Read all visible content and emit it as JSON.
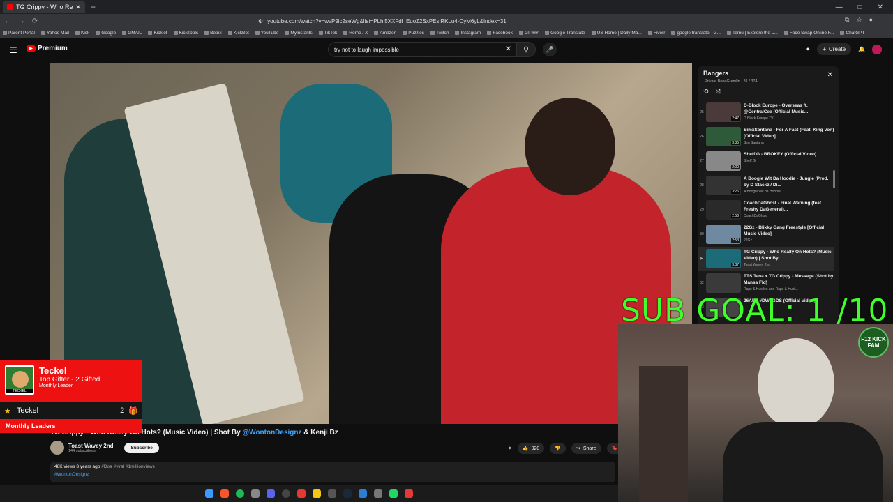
{
  "browser": {
    "tab_title": "TG Crippy - Who Really On Hots",
    "new_tab": "+",
    "url": "youtube.com/watch?v=wvP9ic2seWg&list=PLhl5XXFdl_EuoZ2SxPEslRKLu4-CyM6yL&index=31",
    "window_controls": [
      "—",
      "□",
      "✕"
    ],
    "bookmarks": [
      "Parent Portal",
      "Yahoo Mail",
      "Kick",
      "Google",
      "GMAIL",
      "Kicklet",
      "KickTools",
      "Botrix",
      "KickBot",
      "YouTube",
      "MyInstants",
      "TikTok",
      "Home / X",
      "Amazon",
      "Puzzles",
      "Twitch",
      "Instagram",
      "Facebook",
      "GIPHY",
      "Google Translate",
      "US Home | Daily Ma...",
      "Fiverr",
      "google translate - G...",
      "Temu | Explore the L...",
      "Face Swap Online F...",
      "ChatGPT"
    ]
  },
  "youtube": {
    "logo": "Premium",
    "search_query": "try not to laugh impossible",
    "create_label": "Create"
  },
  "playlist": {
    "title": "Bangers",
    "subtitle": "Private  BoneGremlin · 31 / 374",
    "items": [
      {
        "idx": "25",
        "dur": "2:47",
        "title": "D-Block Europe - Overseas ft. @CentralCee (Official Music...",
        "channel": "D Block Europe TV"
      },
      {
        "idx": "26",
        "dur": "3:35",
        "title": "SimxSantana - For A Fact (Feat. King Von) [Official Video]",
        "channel": "Sim Santana"
      },
      {
        "idx": "27",
        "dur": "2:00",
        "title": "Sheff G - BROKEY (Official Video)",
        "channel": "Sheff G"
      },
      {
        "idx": "28",
        "dur": "3:26",
        "title": "A Boogie Wit Da Hoodie - Jungle (Prod. by D Stackz / Di...",
        "channel": "A Boogie Wit da Hoodie"
      },
      {
        "idx": "29",
        "dur": "2:56",
        "title": "CoachDaGhost - Final Warning (feat. Freshy DaGeneral)...",
        "channel": "CoachDaGhost"
      },
      {
        "idx": "30",
        "dur": "2:53",
        "title": "22Gz - Blixky Gang Freestyle [Official Music Video]",
        "channel": "22Gz"
      },
      {
        "idx": "▶",
        "dur": "3:37",
        "title": "TG Crippy - Who Really On Hots? (Music Video) | Shot By...",
        "channel": "Toast Wavey 2nd"
      },
      {
        "idx": "32",
        "dur": "",
        "title": "TTS Tana x TG Crippy - Message (Shot by Mansa Fld)",
        "channel": "Raps & Hustles and Raps & Hust..."
      },
      {
        "idx": "33",
        "dur": "",
        "title": "26AR - #DWTGDS (Official Video)",
        "channel": ""
      }
    ]
  },
  "video": {
    "title_pre": "TG Crippy - Who Really On Hots? (Music Video) | Shot By ",
    "title_link": "@WontonDesignz",
    "title_post": " & Kenji Bz",
    "channel": "Toast Wavey 2nd",
    "subscribers": "144 subscribers",
    "subscribe": "Subscribe",
    "likes": "920",
    "share": "Share",
    "views_line": "48K views  3 years ago",
    "tags": "#Doa #viral #1millionviews",
    "desc_link": "#WontonDesignz"
  },
  "overlay": {
    "gifter_img_label": "TECKEL",
    "gifter_name": "Teckel",
    "gifter_sub": "Top Gifter - 2 Gifted",
    "gifter_ml": "Monthly Leader",
    "leader_name": "Teckel",
    "leader_count": "2",
    "leaders_title": "Monthly Leaders",
    "sub_goal": "SUB GOAL: 1  /10",
    "cam_logo": "F12 KICK FAM"
  }
}
